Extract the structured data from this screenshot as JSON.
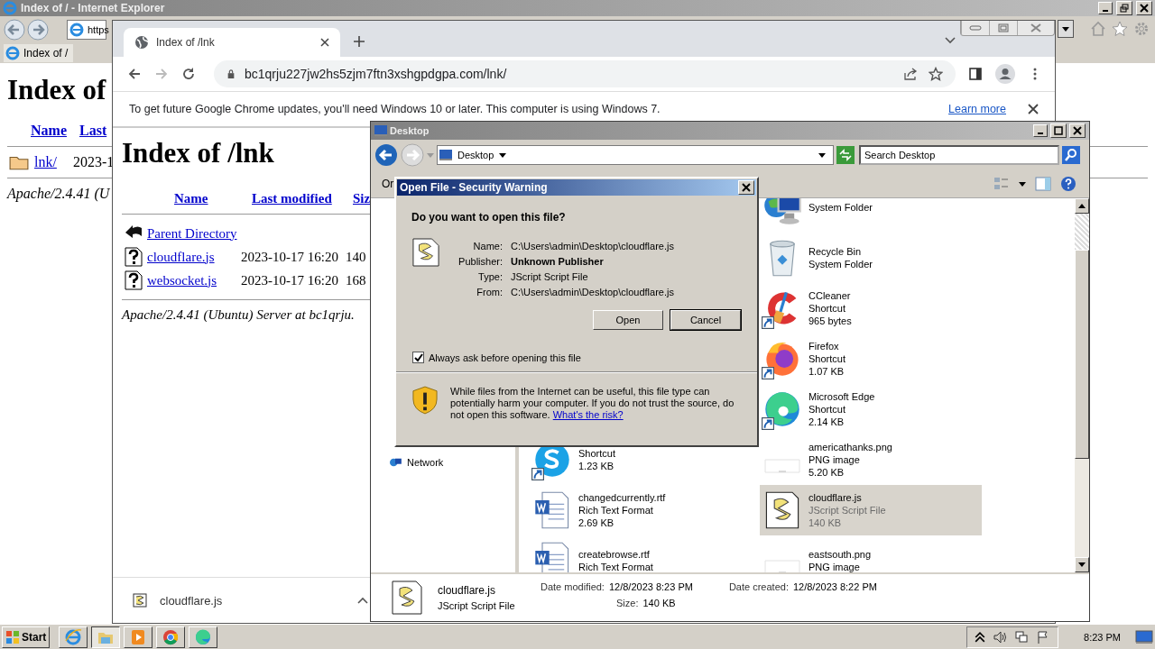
{
  "ie": {
    "title": "Index of / - Internet Explorer",
    "address": "https",
    "tab": "Index of /",
    "heading": "Index of",
    "columns": [
      "Name",
      "Last"
    ],
    "rows": [
      {
        "name": "lnk/",
        "date": "2023-1"
      }
    ],
    "footer": "Apache/2.4.41 (U"
  },
  "chrome": {
    "tab": "Index of /lnk",
    "url": "bc1qrju227jw2hs5zjm7ftn3xshgpdgpa.com/lnk/",
    "infobar": {
      "message": "To get future Google Chrome updates, you'll need Windows 10 or later. This computer is using Windows 7.",
      "link": "Learn more"
    },
    "heading": "Index of /lnk",
    "columns": [
      "Name",
      "Last modified",
      "Siz"
    ],
    "rows": [
      {
        "kind": "parent",
        "name": "Parent Directory"
      },
      {
        "kind": "file",
        "name": "cloudflare.js",
        "date": "2023-10-17 16:20",
        "size": "140"
      },
      {
        "kind": "file",
        "name": "websocket.js",
        "date": "2023-10-17 16:20",
        "size": "168"
      }
    ],
    "footer": "Apache/2.4.41 (Ubuntu) Server at bc1qrju.",
    "download": "cloudflare.js"
  },
  "explorer": {
    "title": "Desktop",
    "location": "Desktop",
    "search_placeholder": "Search Desktop",
    "toolbar_label": "Or",
    "nav": [
      {
        "label": "Network"
      }
    ],
    "file_columns": [
      {
        "items": [
          {
            "kind": "skype",
            "type": "Shortcut",
            "size": "1.23 KB",
            "shortcut": true,
            "selected": false
          },
          {
            "kind": "word",
            "name": "changedcurrently.rtf",
            "type": "Rich Text Format",
            "size": "2.69 KB",
            "shortcut": false,
            "selected": false
          },
          {
            "kind": "word",
            "name": "createbrowse.rtf",
            "type": "Rich Text Format",
            "shortcut": false,
            "selected": false
          }
        ]
      },
      {
        "items": [
          {
            "kind": "network",
            "type": "System Folder",
            "shortcut": false,
            "selected": false
          },
          {
            "kind": "recycle",
            "name": "Recycle Bin",
            "type": "System Folder",
            "shortcut": false,
            "selected": false
          },
          {
            "kind": "ccleaner",
            "name": "CCleaner",
            "type": "Shortcut",
            "size": "965 bytes",
            "shortcut": true,
            "selected": false
          },
          {
            "kind": "firefox",
            "name": "Firefox",
            "type": "Shortcut",
            "size": "1.07 KB",
            "shortcut": true,
            "selected": false
          },
          {
            "kind": "edge",
            "name": "Microsoft Edge",
            "type": "Shortcut",
            "size": "2.14 KB",
            "shortcut": true,
            "selected": false
          },
          {
            "kind": "png",
            "name": "americathanks.png",
            "type": "PNG image",
            "size": "5.20 KB",
            "shortcut": false,
            "selected": false
          },
          {
            "kind": "script",
            "name": "cloudflare.js",
            "type": "JScript Script File",
            "size": "140 KB",
            "shortcut": false,
            "selected": true
          },
          {
            "kind": "png",
            "name": "eastsouth.png",
            "type": "PNG image",
            "shortcut": false,
            "selected": false
          }
        ]
      }
    ],
    "details": {
      "name": "cloudflare.js",
      "type": "JScript Script File",
      "fields": [
        {
          "label": "Date modified:",
          "value": "12/8/2023 8:23 PM"
        },
        {
          "label": "Size:",
          "value": "140 KB"
        },
        {
          "label": "Date created:",
          "value": "12/8/2023 8:22 PM"
        }
      ]
    }
  },
  "dialog": {
    "title": "Open File - Security Warning",
    "question": "Do you want to open this file?",
    "fields": [
      {
        "label": "Name:",
        "value": "C:\\Users\\admin\\Desktop\\cloudflare.js",
        "bold": false
      },
      {
        "label": "Publisher:",
        "value": "Unknown Publisher",
        "bold": true
      },
      {
        "label": "Type:",
        "value": "JScript Script File",
        "bold": false
      },
      {
        "label": "From:",
        "value": "C:\\Users\\admin\\Desktop\\cloudflare.js",
        "bold": false
      }
    ],
    "buttons": [
      {
        "label": "Open",
        "default": false
      },
      {
        "label": "Cancel",
        "default": true
      }
    ],
    "checkbox": {
      "label": "Always ask before opening this file",
      "checked": true
    },
    "warning": "While files from the Internet can be useful, this file type can potentially harm your computer. If you do not trust the source, do not open this software.",
    "link": "What's the risk?"
  },
  "taskbar": {
    "start": "Start",
    "apps": [
      {
        "kind": "ie",
        "selected": false
      },
      {
        "kind": "explorer",
        "selected": true
      },
      {
        "kind": "media",
        "selected": false
      },
      {
        "kind": "chrome",
        "selected": false
      },
      {
        "kind": "edge",
        "selected": false
      }
    ],
    "clock": "8:23 PM"
  }
}
